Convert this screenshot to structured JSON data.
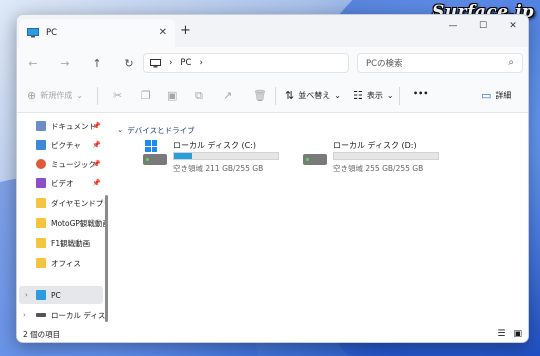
{
  "watermark": "Surface.jp",
  "window": {
    "tab_title": "PC",
    "tab_close": "✕",
    "new_tab": "+",
    "controls": {
      "minimize": "—",
      "maximize": "☐",
      "close": "✕"
    }
  },
  "address": {
    "path": [
      "PC"
    ],
    "search_placeholder": "PCの検索"
  },
  "toolbar": {
    "new_label": "新規作成",
    "sort_label": "並べ替え",
    "view_label": "表示",
    "more_label": "•••",
    "details_label": "詳細"
  },
  "sidebar": {
    "items": [
      {
        "label": "ドキュメント",
        "icon": "documents-icon",
        "color": "#6b8ec9",
        "pinned": true
      },
      {
        "label": "ピクチャ",
        "icon": "pictures-icon",
        "color": "#3a88d8",
        "pinned": true
      },
      {
        "label": "ミュージック",
        "icon": "music-icon",
        "color": "#e0583a",
        "pinned": true
      },
      {
        "label": "ビデオ",
        "icon": "videos-icon",
        "color": "#8d4fc9",
        "pinned": true
      },
      {
        "label": "ダイヤモンドプリンセス",
        "icon": "folder-icon",
        "color": "#f5c542",
        "pinned": false
      },
      {
        "label": "MotoGP観戦動画",
        "icon": "folder-icon",
        "color": "#f5c542",
        "pinned": false
      },
      {
        "label": "F1観戦動画",
        "icon": "folder-icon",
        "color": "#f5c542",
        "pinned": false
      },
      {
        "label": "オフィス",
        "icon": "folder-icon",
        "color": "#f5c542",
        "pinned": false
      }
    ],
    "tree": [
      {
        "label": "PC",
        "icon": "pc-icon",
        "selected": true
      },
      {
        "label": "ローカル ディスク (D:)",
        "icon": "drive-icon",
        "selected": false
      }
    ]
  },
  "content": {
    "group_title": "デバイスとドライブ",
    "drives": [
      {
        "name": "ローカル ディスク (C:)",
        "free": "空き領域 211 GB/255 GB",
        "used_fraction": 0.17,
        "system": true
      },
      {
        "name": "ローカル ディスク (D:)",
        "free": "空き領域 255 GB/255 GB",
        "used_fraction": 0.0,
        "system": false
      }
    ]
  },
  "status": {
    "count": "2 個の項目"
  },
  "colors": {
    "accent": "#26a0da",
    "folder": "#f5c542",
    "selection": "#e5e7ea"
  }
}
